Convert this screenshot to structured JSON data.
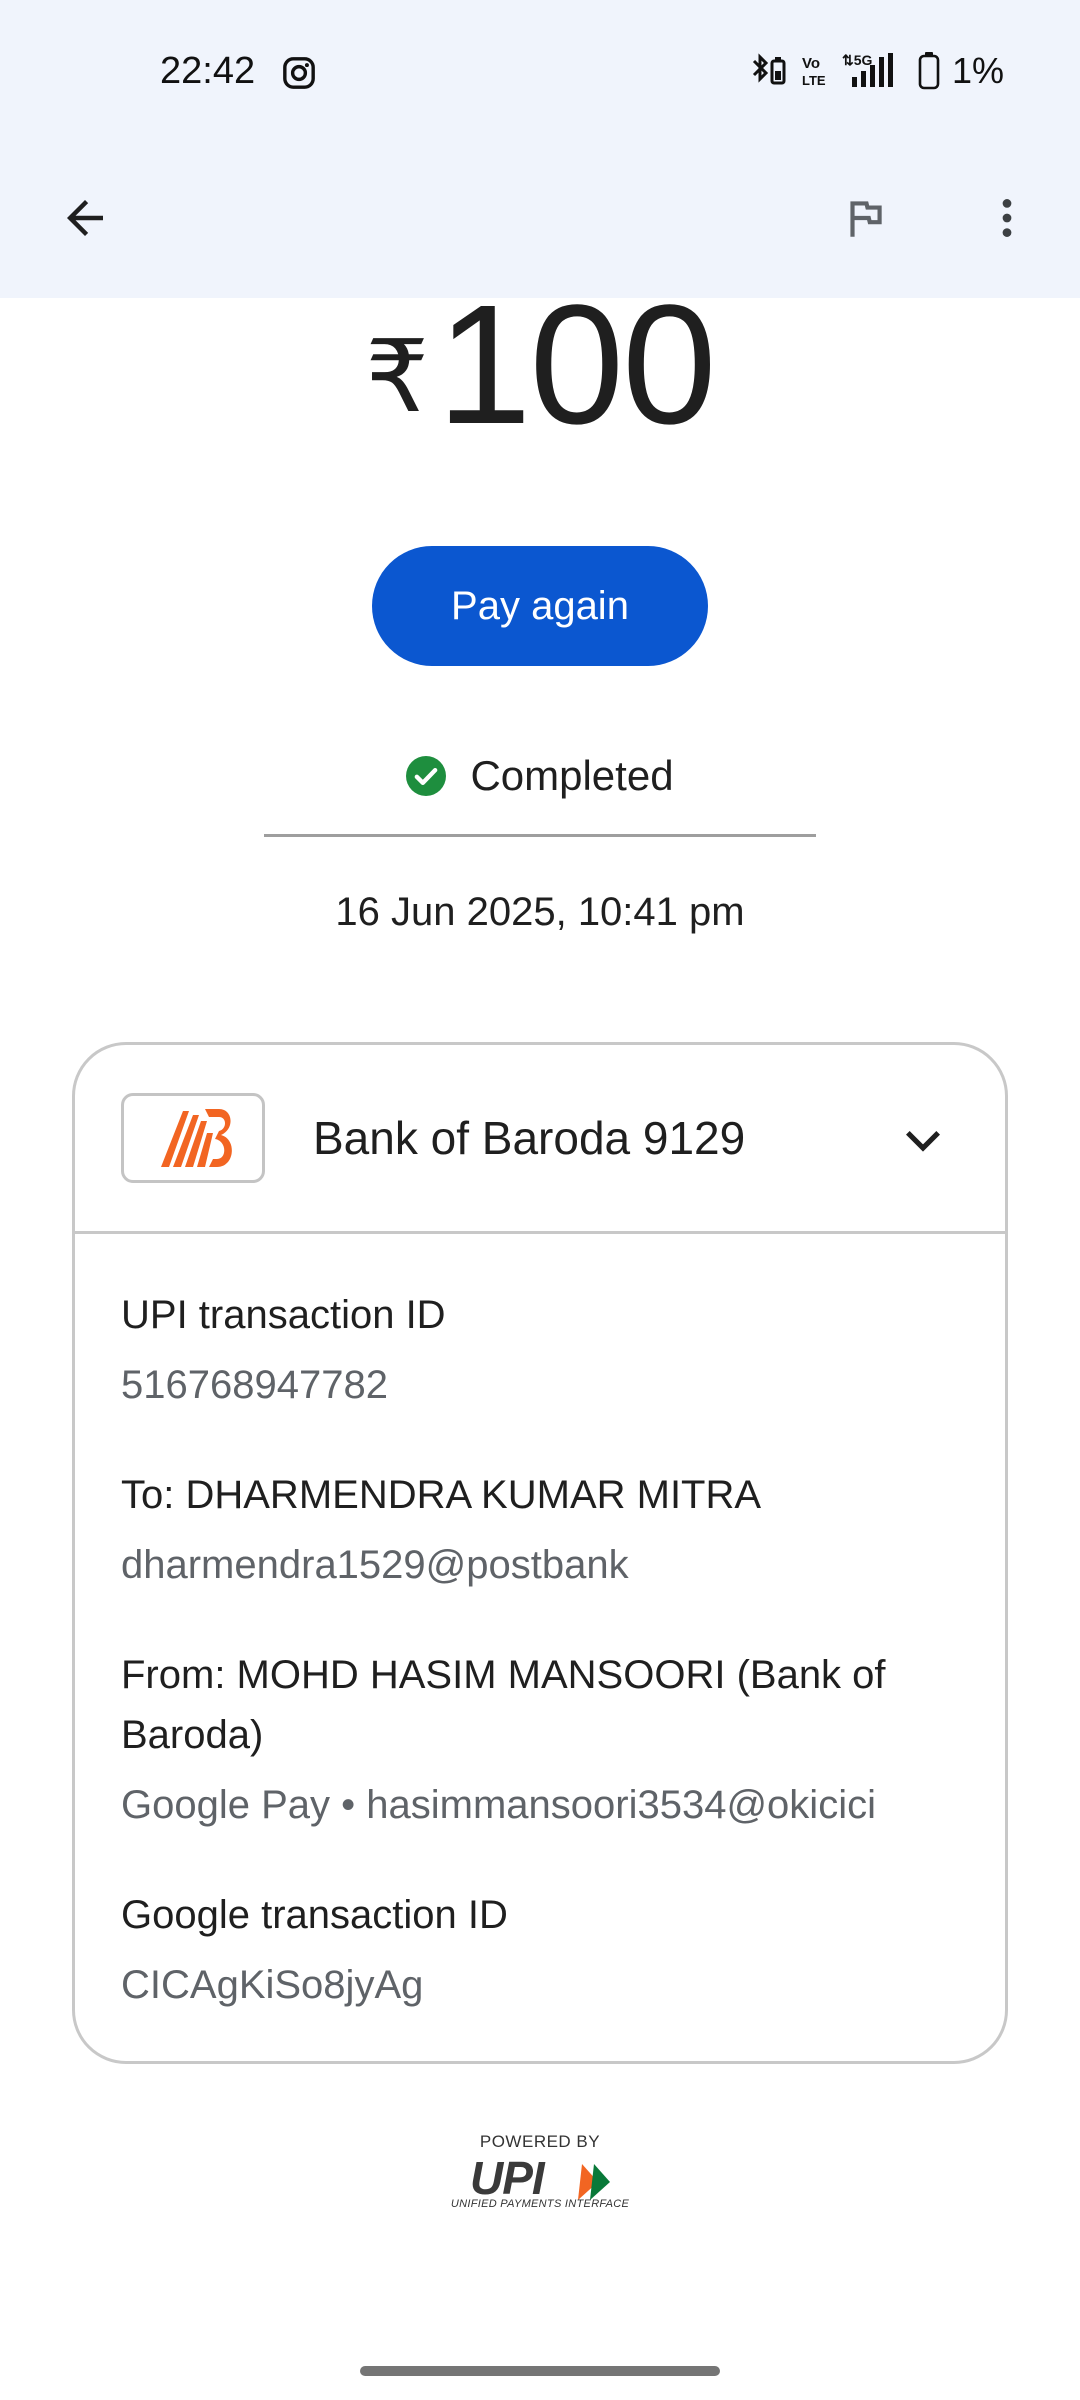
{
  "status_bar": {
    "time": "22:42",
    "battery": "1%",
    "icons": [
      "instagram-icon",
      "bluetooth-battery-icon",
      "volte-icon",
      "5g-signal-icon",
      "battery-icon"
    ]
  },
  "app_bar": {
    "icons": [
      "back-arrow-icon",
      "flag-icon",
      "more-vert-icon"
    ]
  },
  "transaction": {
    "currency": "₹",
    "amount": "100",
    "pay_again_label": "Pay again",
    "status": "Completed",
    "datetime": "16 Jun 2025, 10:41 pm"
  },
  "card": {
    "bank_name": "Bank of Baroda 9129",
    "details": [
      {
        "label": "UPI transaction ID",
        "value": "516768947782"
      },
      {
        "label": "To: DHARMENDRA KUMAR MITRA",
        "value": "dharmendra1529@postbank"
      },
      {
        "label": "From: MOHD HASIM MANSOORI (Bank of Baroda)",
        "value": "Google Pay • hasimmansoori3534@okicici"
      },
      {
        "label": "Google transaction ID",
        "value": "CICAgKiSo8jyAg"
      }
    ]
  },
  "footer": {
    "powered_by": "POWERED BY",
    "logo_text": "UPI",
    "logo_subtext": "UNIFIED PAYMENTS INTERFACE"
  },
  "colors": {
    "accent": "#0b57d0",
    "success": "#1e8e3e",
    "header_bg": "#f0f4fc",
    "bank_orange": "#f26522"
  }
}
